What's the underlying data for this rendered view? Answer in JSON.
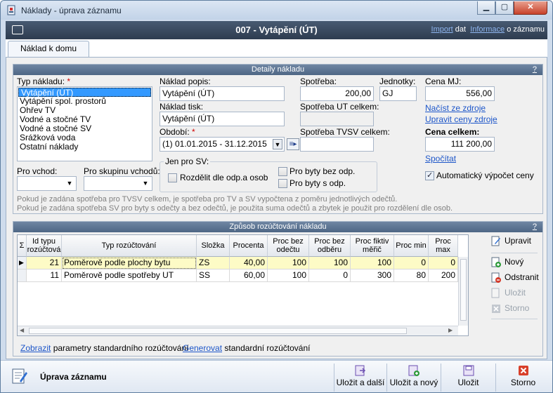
{
  "window": {
    "title": "Náklady - úprava záznamu",
    "btn_min": "▁",
    "btn_max": "▢",
    "btn_close": "✕"
  },
  "header": {
    "title": "007 - Vytápění (ÚT)",
    "link_import": "Import",
    "text_dat": "dat",
    "link_info": "Informace",
    "text_about": "o záznamu"
  },
  "tabs": [
    {
      "label": "Náklad k domu"
    }
  ],
  "details": {
    "title": "Detaily nákladu",
    "help": "?",
    "type_label": "Typ nákladu:",
    "req": "*",
    "types": [
      "Vytápění (ÚT)",
      "Vytápění spol. prostorů",
      "Ohřev TV",
      "Vodné a stočné TV",
      "Vodné a stočné SV",
      "Srážková voda",
      "Ostatní náklady"
    ],
    "desc_label": "Náklad popis:",
    "desc_value": "Vytápění (ÚT)",
    "print_label": "Náklad tisk:",
    "print_value": "Vytápění (ÚT)",
    "period_label": "Období:",
    "period_value": "(1) 01.01.2015 - 31.12.2015",
    "consumption_label": "Spotřeba:",
    "consumption_value": "200,00",
    "unit_label": "Jednotky:",
    "unit_value": "GJ",
    "price_label": "Cena MJ:",
    "price_value": "556,00",
    "link_load": "Načíst ze zdroje",
    "link_adjust": "Upravit ceny zdroje",
    "total_label": "Cena celkem:",
    "total_value": "111 200,00",
    "link_calc": "Spočítat",
    "ut_total_label": "Spotřeba UT celkem:",
    "tvsv_total_label": "Spotřeba TVSV celkem:",
    "entry_label": "Pro vchod:",
    "group_label": "Pro skupinu vchodů:",
    "sv_legend": "Jen pro SV:",
    "split_label": "Rozdělit dle odp.a osob",
    "no_meter_label": "Pro byty bez odp.",
    "with_meter_label": "Pro byty s odp.",
    "auto_label": "Automatický výpočet ceny",
    "note1": "Pokud je zadána spotřeba pro TVSV celkem, je spotřeba pro TV a SV vypočtena z poměru jednotlivých odečtů.",
    "note2": "Pokud je zadána spotřeba SV pro byty s odečty a bez odečtů, je použita suma odečtů a zbytek je použit pro rozdělení dle osob."
  },
  "distribution": {
    "title": "Způsob rozúčtování nákladu",
    "help": "?",
    "columns": [
      "Σ",
      "Id typu rozúčtová",
      "Typ rozúčtování",
      "Složka",
      "Procenta",
      "Proc bez odečtu",
      "Proc bez odběru",
      "Proc fiktiv měřič",
      "Proc min",
      "Proc max"
    ],
    "rows": [
      {
        "marker": "▶",
        "id": "21",
        "type": "Poměrově podle plochy bytu",
        "part": "ZS",
        "pct": "40,00",
        "no_read": "100",
        "no_use": "100",
        "fict": "100",
        "min": "0",
        "max": "0"
      },
      {
        "marker": "",
        "id": "11",
        "type": "Poměrově podle spotřeby UT",
        "part": "SS",
        "pct": "60,00",
        "no_read": "100",
        "no_use": "0",
        "fict": "300",
        "min": "80",
        "max": "200"
      }
    ],
    "btn_edit": "Upravit",
    "btn_new": "Nový",
    "btn_delete": "Odstranit",
    "btn_save": "Uložit",
    "btn_cancel": "Storno",
    "link_show": "Zobrazit",
    "text_show": "parametry standardního rozúčtování",
    "link_gen": "Generovat",
    "text_gen": "standardní rozúčtování"
  },
  "footer": {
    "title": "Úprava záznamu",
    "btn_save_next": "Uložit a další",
    "btn_save_new": "Uložit a nový",
    "btn_save": "Uložit",
    "btn_cancel": "Storno"
  },
  "colors": {
    "header_bg": "#3a4a5e",
    "accent_link": "#1d56c9",
    "selected_row": "#fdfbc6",
    "list_selection": "#3399ff",
    "required": "#d00000"
  }
}
